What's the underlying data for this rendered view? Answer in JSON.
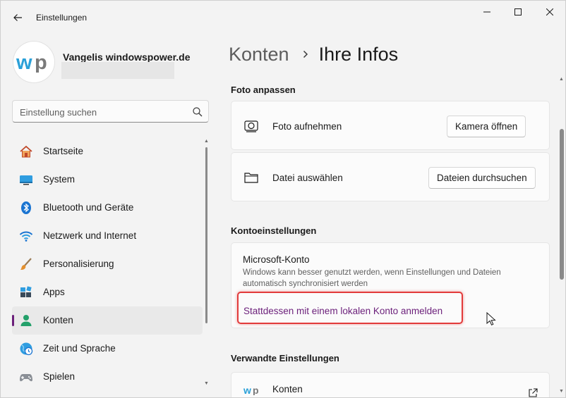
{
  "window": {
    "title": "Einstellungen",
    "back_icon": "arrow-left-icon",
    "minimize_icon": "minimize-icon",
    "maximize_icon": "maximize-icon",
    "close_icon": "close-icon"
  },
  "profile": {
    "avatar_icon": "wp-logo-icon",
    "name": "Vangelis windowspower.de",
    "accent": "#6b1f7a"
  },
  "search": {
    "placeholder": "Einstellung suchen",
    "value": "",
    "icon": "search-icon"
  },
  "sidebar": {
    "items": [
      {
        "id": "startseite",
        "label": "Startseite",
        "icon": "home-icon",
        "selected": false
      },
      {
        "id": "system",
        "label": "System",
        "icon": "monitor-icon",
        "selected": false
      },
      {
        "id": "bluetooth",
        "label": "Bluetooth und Geräte",
        "icon": "bluetooth-icon",
        "selected": false
      },
      {
        "id": "netzwerk",
        "label": "Netzwerk und Internet",
        "icon": "wifi-icon",
        "selected": false
      },
      {
        "id": "personalisierung",
        "label": "Personalisierung",
        "icon": "brush-icon",
        "selected": false
      },
      {
        "id": "apps",
        "label": "Apps",
        "icon": "apps-icon",
        "selected": false
      },
      {
        "id": "konten",
        "label": "Konten",
        "icon": "person-icon",
        "selected": true
      },
      {
        "id": "zeit",
        "label": "Zeit und Sprache",
        "icon": "clock-globe-icon",
        "selected": false
      },
      {
        "id": "spielen",
        "label": "Spielen",
        "icon": "gamepad-icon",
        "selected": false
      }
    ]
  },
  "breadcrumb": {
    "parent": "Konten",
    "separator_icon": "chevron-right-icon",
    "current": "Ihre Infos"
  },
  "photo": {
    "section_title": "Foto anpassen",
    "take_photo": {
      "label": "Foto aufnehmen",
      "icon": "camera-icon",
      "button": "Kamera öffnen"
    },
    "choose_file": {
      "label": "Datei auswählen",
      "icon": "folder-icon",
      "button": "Dateien durchsuchen"
    }
  },
  "account_settings": {
    "section_title": "Kontoeinstellungen",
    "microsoft_account": {
      "title": "Microsoft-Konto",
      "description": "Windows kann besser genutzt werden, wenn Einstellungen und Dateien automatisch synchronisiert werden",
      "link": "Stattdessen mit einem lokalen Konto anmelden"
    },
    "highlight_color": "#e23b3b"
  },
  "related": {
    "section_title": "Verwandte Einstellungen",
    "items": [
      {
        "label": "Konten",
        "icon": "wp-logo-icon",
        "action_icon": "external-link-icon"
      }
    ]
  }
}
